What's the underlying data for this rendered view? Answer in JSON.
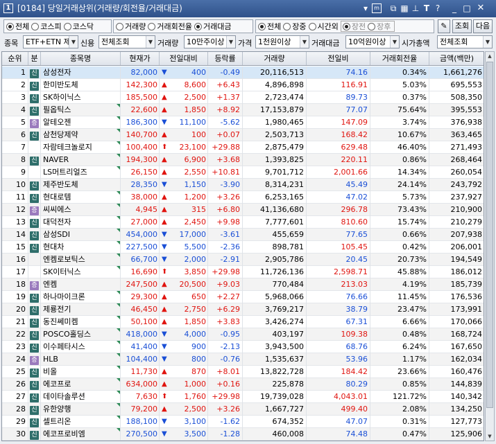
{
  "window": {
    "number": "1",
    "title": "[0184] 당일거래상위(거래량/회전율/거래대금)",
    "icons": [
      "expand-icon",
      "memo-icon",
      "link-icon",
      "grid-icon",
      "pin-icon",
      "font-icon",
      "help-icon",
      "minimize-icon",
      "maximize-icon",
      "close-icon"
    ]
  },
  "market_filter": {
    "options": [
      "전체",
      "코스피",
      "코스닥"
    ],
    "selected": "전체"
  },
  "sort_filter": {
    "options": [
      "거래량",
      "거래회전율",
      "거래대금"
    ],
    "selected": "거래대금"
  },
  "session_filter": {
    "options": [
      "전체",
      "장중",
      "시간외"
    ],
    "selected": "전체",
    "sub_options": [
      "장전",
      "장후"
    ]
  },
  "buttons": {
    "search": "조회",
    "next": "다음",
    "settings_icon": "settings-icon"
  },
  "filters": {
    "stock_label": "종목",
    "stock_value": "ETF+ETN 제",
    "credit_label": "신용",
    "credit_value": "전체조회",
    "volume_label": "거래량",
    "volume_value": "10만주이상",
    "price_label": "가격",
    "price_value": "1천원이상",
    "amount_label": "거래대금",
    "amount_value": "10억원이상",
    "mcap_label": "시가총액",
    "mcap_value": "전체조회"
  },
  "table": {
    "headers": [
      "순위",
      "분",
      "종목명",
      "현재가",
      "전일대비",
      "등락률",
      "거래량",
      "전일비",
      "거래회전율",
      "금액(백만)"
    ],
    "rows": [
      {
        "rank": "1",
        "badge": "신",
        "name": "삼성전자",
        "price": "82,000",
        "dir": "dn",
        "chg": "400",
        "rate": "-0.49",
        "vol": "20,116,513",
        "prev": "74.16",
        "turn": "0.34%",
        "amt": "1,661,276"
      },
      {
        "rank": "2",
        "badge": "신",
        "name": "한미반도체",
        "price": "142,300",
        "dir": "up",
        "chg": "8,600",
        "rate": "+6.43",
        "vol": "4,896,898",
        "prev": "116.91",
        "turn": "5.03%",
        "amt": "695,553"
      },
      {
        "rank": "3",
        "badge": "신",
        "name": "SK하이닉스",
        "price": "185,500",
        "dir": "up",
        "chg": "2,500",
        "rate": "+1.37",
        "vol": "2,723,474",
        "prev": "89.73",
        "turn": "0.37%",
        "amt": "508,350"
      },
      {
        "rank": "4",
        "badge": "신",
        "name": "필옵틱스",
        "price": "22,600",
        "dir": "up",
        "chg": "1,850",
        "rate": "+8.92",
        "vol": "17,153,879",
        "prev": "77.07",
        "turn": "75.64%",
        "amt": "395,553"
      },
      {
        "rank": "5",
        "badge": "증",
        "name": "알테오젠",
        "price": "186,300",
        "dir": "dn",
        "chg": "11,100",
        "rate": "-5.62",
        "vol": "1,980,465",
        "prev": "147.09",
        "turn": "3.74%",
        "amt": "376,938"
      },
      {
        "rank": "6",
        "badge": "신",
        "name": "삼천당제약",
        "price": "140,700",
        "dir": "up",
        "chg": "100",
        "rate": "+0.07",
        "vol": "2,503,713",
        "prev": "168.42",
        "turn": "10.67%",
        "amt": "363,465"
      },
      {
        "rank": "7",
        "badge": "",
        "name": "자람테크놀로지",
        "price": "100,400",
        "dir": "uplim",
        "chg": "23,100",
        "rate": "+29.88",
        "vol": "2,875,479",
        "prev": "629.48",
        "turn": "46.40%",
        "amt": "271,493"
      },
      {
        "rank": "8",
        "badge": "신",
        "name": "NAVER",
        "price": "194,300",
        "dir": "up",
        "chg": "6,900",
        "rate": "+3.68",
        "vol": "1,393,825",
        "prev": "220.11",
        "turn": "0.86%",
        "amt": "268,464"
      },
      {
        "rank": "9",
        "badge": "",
        "name": "LS머트리얼즈",
        "price": "26,150",
        "dir": "up",
        "chg": "2,550",
        "rate": "+10.81",
        "vol": "9,701,712",
        "prev": "2,001.66",
        "turn": "14.34%",
        "amt": "260,054"
      },
      {
        "rank": "10",
        "badge": "신",
        "name": "제주반도체",
        "price": "28,350",
        "dir": "dn",
        "chg": "1,150",
        "rate": "-3.90",
        "vol": "8,314,231",
        "prev": "45.49",
        "turn": "24.14%",
        "amt": "243,792"
      },
      {
        "rank": "11",
        "badge": "신",
        "name": "현대로템",
        "price": "38,000",
        "dir": "up",
        "chg": "1,200",
        "rate": "+3.26",
        "vol": "6,253,165",
        "prev": "47.02",
        "turn": "5.73%",
        "amt": "237,927"
      },
      {
        "rank": "12",
        "badge": "증",
        "name": "씨씨에스",
        "price": "4,945",
        "dir": "up",
        "chg": "315",
        "rate": "+6.80",
        "vol": "41,136,680",
        "prev": "296.78",
        "turn": "73.43%",
        "amt": "210,900"
      },
      {
        "rank": "13",
        "badge": "신",
        "name": "대덕전자",
        "price": "27,000",
        "dir": "up",
        "chg": "2,450",
        "rate": "+9.98",
        "vol": "7,777,601",
        "prev": "810.60",
        "turn": "15.74%",
        "amt": "210,279"
      },
      {
        "rank": "14",
        "badge": "신",
        "name": "삼성SDI",
        "price": "454,000",
        "dir": "dn",
        "chg": "17,000",
        "rate": "-3.61",
        "vol": "455,659",
        "prev": "77.65",
        "turn": "0.66%",
        "amt": "207,938"
      },
      {
        "rank": "15",
        "badge": "신",
        "name": "현대차",
        "price": "227,500",
        "dir": "dn",
        "chg": "5,500",
        "rate": "-2.36",
        "vol": "898,781",
        "prev": "105.45",
        "turn": "0.42%",
        "amt": "206,001"
      },
      {
        "rank": "16",
        "badge": "",
        "name": "엔켐로보틱스",
        "price": "66,700",
        "dir": "dn",
        "chg": "2,000",
        "rate": "-2.91",
        "vol": "2,905,786",
        "prev": "20.45",
        "turn": "20.73%",
        "amt": "194,549"
      },
      {
        "rank": "17",
        "badge": "",
        "name": "SK이터닉스",
        "price": "16,690",
        "dir": "uplim",
        "chg": "3,850",
        "rate": "+29.98",
        "vol": "11,726,136",
        "prev": "2,598.71",
        "turn": "45.88%",
        "amt": "186,012"
      },
      {
        "rank": "18",
        "badge": "증",
        "name": "엔켐",
        "price": "247,500",
        "dir": "up",
        "chg": "20,500",
        "rate": "+9.03",
        "vol": "770,484",
        "prev": "213.03",
        "turn": "4.19%",
        "amt": "185,739"
      },
      {
        "rank": "19",
        "badge": "신",
        "name": "하나마이크론",
        "price": "29,300",
        "dir": "up",
        "chg": "650",
        "rate": "+2.27",
        "vol": "5,968,066",
        "prev": "76.66",
        "turn": "11.45%",
        "amt": "176,536"
      },
      {
        "rank": "20",
        "badge": "신",
        "name": "제룡전기",
        "price": "46,450",
        "dir": "up",
        "chg": "2,750",
        "rate": "+6.29",
        "vol": "3,769,217",
        "prev": "38.79",
        "turn": "23.47%",
        "amt": "173,991"
      },
      {
        "rank": "21",
        "badge": "신",
        "name": "동진쎄미켐",
        "price": "50,100",
        "dir": "up",
        "chg": "1,850",
        "rate": "+3.83",
        "vol": "3,426,274",
        "prev": "67.31",
        "turn": "6.66%",
        "amt": "170,066"
      },
      {
        "rank": "22",
        "badge": "신",
        "name": "POSCO홀딩스",
        "price": "418,000",
        "dir": "dn",
        "chg": "4,000",
        "rate": "-0.95",
        "vol": "403,197",
        "prev": "109.38",
        "turn": "0.48%",
        "amt": "168,724"
      },
      {
        "rank": "23",
        "badge": "신",
        "name": "이수페타시스",
        "price": "41,400",
        "dir": "dn",
        "chg": "900",
        "rate": "-2.13",
        "vol": "3,943,500",
        "prev": "68.76",
        "turn": "6.24%",
        "amt": "167,650"
      },
      {
        "rank": "24",
        "badge": "증",
        "name": "HLB",
        "price": "104,400",
        "dir": "dn",
        "chg": "800",
        "rate": "-0.76",
        "vol": "1,535,637",
        "prev": "53.96",
        "turn": "1.17%",
        "amt": "162,034"
      },
      {
        "rank": "25",
        "badge": "신",
        "name": "비올",
        "price": "11,730",
        "dir": "up",
        "chg": "870",
        "rate": "+8.01",
        "vol": "13,822,728",
        "prev": "184.42",
        "turn": "23.66%",
        "amt": "160,476"
      },
      {
        "rank": "26",
        "badge": "신",
        "name": "에코프로",
        "price": "634,000",
        "dir": "up",
        "chg": "1,000",
        "rate": "+0.16",
        "vol": "225,878",
        "prev": "80.29",
        "turn": "0.85%",
        "amt": "144,839"
      },
      {
        "rank": "27",
        "badge": "신",
        "name": "데이타솔루션",
        "price": "7,630",
        "dir": "uplim",
        "chg": "1,760",
        "rate": "+29.98",
        "vol": "19,739,028",
        "prev": "4,043.01",
        "turn": "121.72%",
        "amt": "140,342"
      },
      {
        "rank": "28",
        "badge": "신",
        "name": "유한양행",
        "price": "79,200",
        "dir": "up",
        "chg": "2,500",
        "rate": "+3.26",
        "vol": "1,667,727",
        "prev": "499.40",
        "turn": "2.08%",
        "amt": "134,250"
      },
      {
        "rank": "29",
        "badge": "신",
        "name": "셀트리온",
        "price": "188,100",
        "dir": "dn",
        "chg": "3,100",
        "rate": "-1.62",
        "vol": "674,352",
        "prev": "47.07",
        "turn": "0.31%",
        "amt": "127,773"
      },
      {
        "rank": "30",
        "badge": "신",
        "name": "에코프로비엠",
        "price": "270,500",
        "dir": "dn",
        "chg": "3,500",
        "rate": "-1.28",
        "vol": "460,008",
        "prev": "74.48",
        "turn": "0.47%",
        "amt": "125,906"
      }
    ]
  },
  "colors": {
    "up": "#e0140f",
    "down": "#1a4fd6",
    "title_bar": "#2e518a",
    "badge_sin": "#2e6e6a",
    "badge_jeung": "#9a7abd"
  }
}
